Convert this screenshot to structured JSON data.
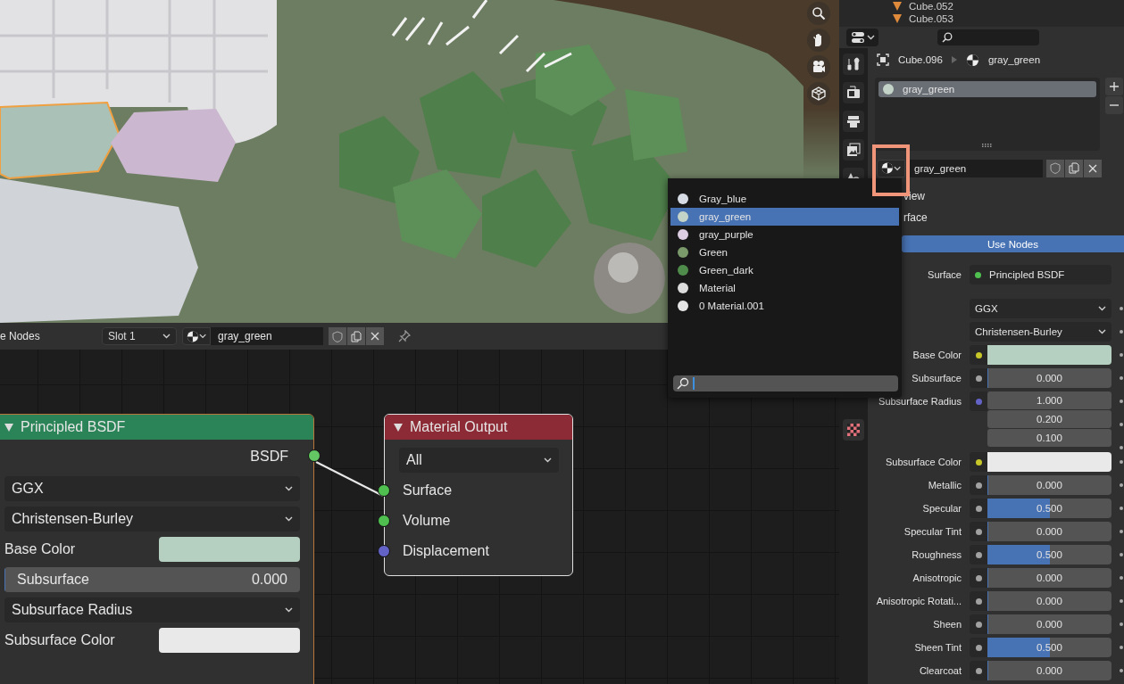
{
  "outliner": {
    "rows": [
      {
        "name": "Cube.052"
      },
      {
        "name": "Cube.053"
      }
    ]
  },
  "properties": {
    "breadcrumb": {
      "object": "Cube.096",
      "material": "gray_green"
    },
    "material_slots": [
      {
        "name": "gray_green",
        "selected": true
      }
    ],
    "material_field": "gray_green",
    "panels": [
      {
        "title": "view"
      },
      {
        "title": "rface"
      }
    ],
    "use_nodes_button": "Use Nodes",
    "rows": [
      {
        "kind": "link",
        "label": "Surface",
        "value": "Principled BSDF"
      },
      {
        "kind": "dropdown",
        "value": "GGX"
      },
      {
        "kind": "dropdown",
        "value": "Christensen-Burley"
      },
      {
        "kind": "color",
        "label": "Base Color",
        "color": "#b5cfc0"
      },
      {
        "kind": "slider",
        "label": "Subsurface",
        "value": "0.000",
        "level": 0
      },
      {
        "kind": "vector",
        "label": "Subsurface Radius",
        "values": [
          "1.000",
          "0.200",
          "0.100"
        ]
      },
      {
        "kind": "color",
        "label": "Subsurface Color",
        "color": "#e9e9e9"
      },
      {
        "kind": "slider",
        "label": "Metallic",
        "value": "0.000",
        "level": 0
      },
      {
        "kind": "slider",
        "label": "Specular",
        "value": "0.500",
        "level": 0.5
      },
      {
        "kind": "slider",
        "label": "Specular Tint",
        "value": "0.000",
        "level": 0
      },
      {
        "kind": "slider",
        "label": "Roughness",
        "value": "0.500",
        "level": 0.5
      },
      {
        "kind": "slider",
        "label": "Anisotropic",
        "value": "0.000",
        "level": 0
      },
      {
        "kind": "slider",
        "label": "Anisotropic Rotati...",
        "value": "0.000",
        "level": 0
      },
      {
        "kind": "slider",
        "label": "Sheen",
        "value": "0.000",
        "level": 0
      },
      {
        "kind": "slider",
        "label": "Sheen Tint",
        "value": "0.500",
        "level": 0.5
      },
      {
        "kind": "slider",
        "label": "Clearcoat",
        "value": "0.000",
        "level": 0
      }
    ]
  },
  "node_editor": {
    "header": {
      "mode_label": "e Nodes",
      "slot": "Slot 1",
      "material": "gray_green"
    },
    "nodes": [
      {
        "kind": "bsdf",
        "title": "Principled BSDF",
        "output": "BSDF",
        "rows": [
          {
            "kind": "dropdown",
            "value": "GGX"
          },
          {
            "kind": "dropdown",
            "value": "Christensen-Burley"
          },
          {
            "kind": "color",
            "label": "Base Color",
            "color": "#b5cfc0"
          },
          {
            "kind": "slider",
            "label": "Subsurface",
            "value": "0.000",
            "level": 0
          },
          {
            "kind": "dropdown",
            "value": "Subsurface Radius"
          },
          {
            "kind": "color",
            "label": "Subsurface Color",
            "color": "#e9e9e9"
          }
        ]
      },
      {
        "kind": "output",
        "title": "Material Output",
        "target": "All",
        "inputs": [
          {
            "label": "Surface",
            "kind": "shader"
          },
          {
            "label": "Volume",
            "kind": "shader"
          },
          {
            "label": "Displacement",
            "kind": "vector"
          }
        ]
      }
    ]
  },
  "material_menu": {
    "items": [
      {
        "name": "Gray_blue",
        "color": "#d6dbe4",
        "selected": false
      },
      {
        "name": "gray_green",
        "color": "#c3d3c7",
        "selected": true
      },
      {
        "name": "gray_purple",
        "color": "#ddcde2",
        "selected": false
      },
      {
        "name": "Green",
        "color": "#7b9a6c",
        "selected": false
      },
      {
        "name": "Green_dark",
        "color": "#4f8c4c",
        "selected": false
      },
      {
        "name": "Material",
        "color": "#dcdcdc",
        "selected": false
      },
      {
        "name": "0 Material.001",
        "color": "#e6e6e6",
        "selected": false
      }
    ]
  }
}
